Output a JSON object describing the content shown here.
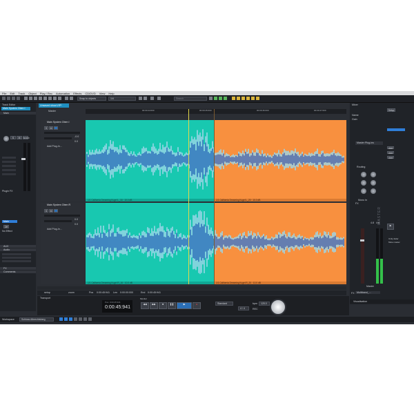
{
  "menu": [
    "File",
    "Edit",
    "Track",
    "Object",
    "Play / Rec",
    "Automation",
    "Effects",
    "CD/DVD",
    "View",
    "Help"
  ],
  "toolbar": {
    "snap_mode": "Snap to objects",
    "grid_value": "1/4",
    "search_placeholder": "Search"
  },
  "track_editor": {
    "title": "Track Editor",
    "selected_track": "Main System Oben I",
    "section_main": "Main",
    "section_plugin_fx": "Plugin FX",
    "section_aux": "AUX",
    "section_audio": "Audio",
    "section_fx": "FX",
    "section_comments": "Comments",
    "off_label": "Off",
    "no_effect": "No Effect",
    "routing_label": "Main"
  },
  "arranger": {
    "project_tab": "Unsaved show.VIP*",
    "master_label": "Master",
    "timeline": [
      "00:00:44:000",
      "00:00:45:000",
      "00:00:46:000",
      "00:00:47:000"
    ],
    "tracks": [
      {
        "name": "Main System Oben I",
        "plugin": "Add Plug-In...",
        "level_left": "-0.0",
        "level_right": "0.0"
      },
      {
        "name": "Main System Oben R",
        "plugin": "Add Plug-In...",
        "level_left": "0.0",
        "level_right": "0.0"
      }
    ],
    "clips": [
      "1/1 California Dreaming Kugel L_16 · 10.0 dB",
      "1/1 California Dreaming Kugel L_20 · 10.0 dB",
      "1/1 California Dreaming Kugel R_16 · 10.0 dB",
      "1/1 California Dreaming Kugel R_20 · 10.0 dB"
    ],
    "bottom_bar": {
      "setup_label": "setup",
      "zoom_label": "zoom",
      "pos_label": "Pos",
      "pos_value": "0:00:45:941",
      "len_label": "Len",
      "len_value": "0:00:00:000",
      "end_label": "End",
      "end_value": "0:00:45:941"
    }
  },
  "transport": {
    "title": "Transport",
    "time": "0:00:45:941",
    "time_small": "Pos: 0:00:45:941",
    "mode": "Standard",
    "bpm_label": "bpm",
    "bpm": "120.0",
    "signature": "4 / 4",
    "monitor_label": "Monitor",
    "record_label": "REC"
  },
  "mixer": {
    "title": "Mixer",
    "setup": "Setup",
    "name_field": "Name",
    "gain_label": "Gain",
    "mono_label": "MONO",
    "fx_label": "FX",
    "plugin_header": "Master Plug-ins",
    "plugins": [
      "Add",
      "Add",
      "Add"
    ],
    "routing_header": "Routing",
    "master_vertical": "MASTER",
    "mono_in": "Mono In",
    "meter_values": [
      "4.8",
      "4.8"
    ],
    "checkbox_1": "Unity fader",
    "checkbox_2": "Mute master",
    "master_name": "Master",
    "bottom_label": "FX",
    "bottom_value": "Multiband_..."
  },
  "statusbar": {
    "workspace_label": "Workspace",
    "workspace_value": "Schloss Albrechtsberg",
    "visualisation": "Visualisation"
  },
  "colors": {
    "track_a": "#18c8b0",
    "track_b": "#f8903f",
    "accent_blue": "#2f7ed8",
    "wave_light": "#9bd6e8",
    "wave_dark": "#2957b8"
  }
}
